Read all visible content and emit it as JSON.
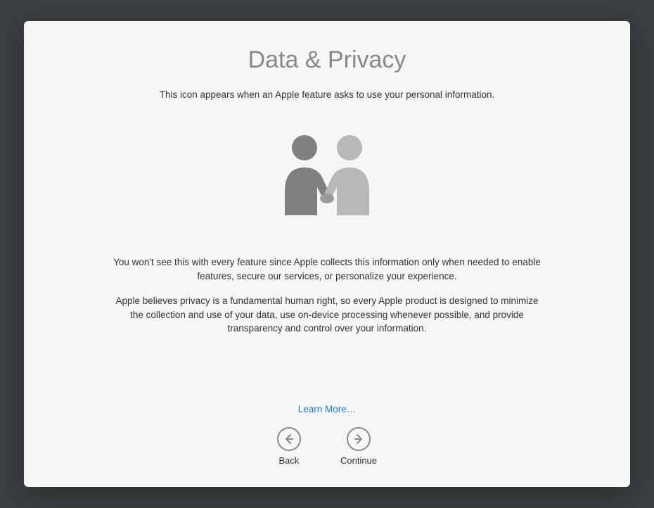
{
  "title": "Data & Privacy",
  "subtitle": "This icon appears when an Apple feature asks to use your personal information.",
  "paragraph1": "You won't see this with every feature since Apple collects this information only when needed to enable features, secure our services, or personalize your experience.",
  "paragraph2": "Apple believes privacy is a fundamental human right, so every Apple product is designed to minimize the collection and use of your data, use on-device processing whenever possible, and provide transparency and control over your information.",
  "learn_more": "Learn More…",
  "nav": {
    "back": "Back",
    "continue": "Continue"
  }
}
